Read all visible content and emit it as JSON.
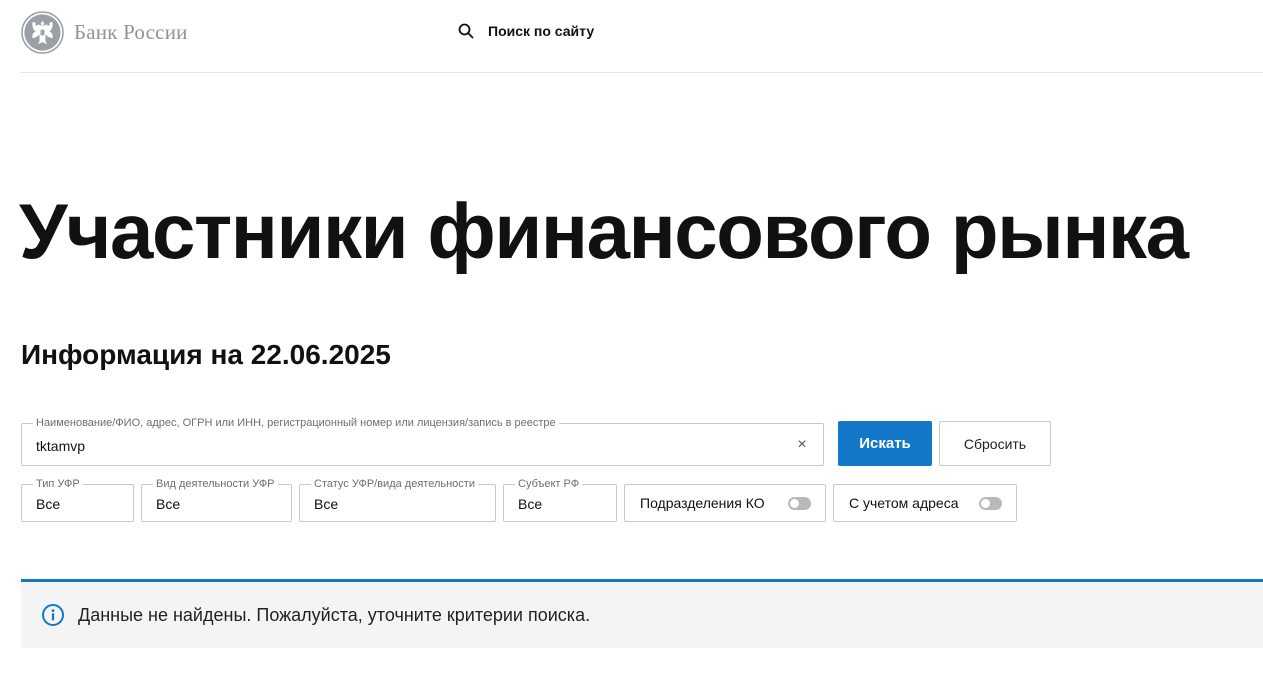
{
  "header": {
    "logo_text": "Банк России",
    "search_label": "Поиск по сайту"
  },
  "page_title": "Участники финансового рынка",
  "info_date": "Информация на 22.06.2025",
  "search_form": {
    "legend": "Наименование/ФИО, адрес, ОГРН или ИНН, регистрационный номер или лицензия/запись в реестре",
    "value": "tktamvp",
    "clear_symbol": "×",
    "submit_label": "Искать",
    "reset_label": "Сбросить"
  },
  "filters": [
    {
      "legend": "Тип УФР",
      "value": "Все"
    },
    {
      "legend": "Вид деятельности УФР",
      "value": "Все"
    },
    {
      "legend": "Статус УФР/вида деятельности",
      "value": "Все"
    },
    {
      "legend": "Субъект РФ",
      "value": "Все"
    }
  ],
  "toggles": [
    {
      "label": "Подразделения КО",
      "on": false
    },
    {
      "label": "С учетом адреса",
      "on": false
    }
  ],
  "notice": {
    "text": "Данные не найдены. Пожалуйста, уточните критерии поиска."
  },
  "colors": {
    "accent": "#1478c8",
    "logo_gray": "#8f9499",
    "notice_bg": "#f4f4f4"
  },
  "icons": {
    "logo": "double-headed-eagle-emblem",
    "search": "search-icon",
    "clear": "close-icon",
    "notice": "info-icon"
  }
}
